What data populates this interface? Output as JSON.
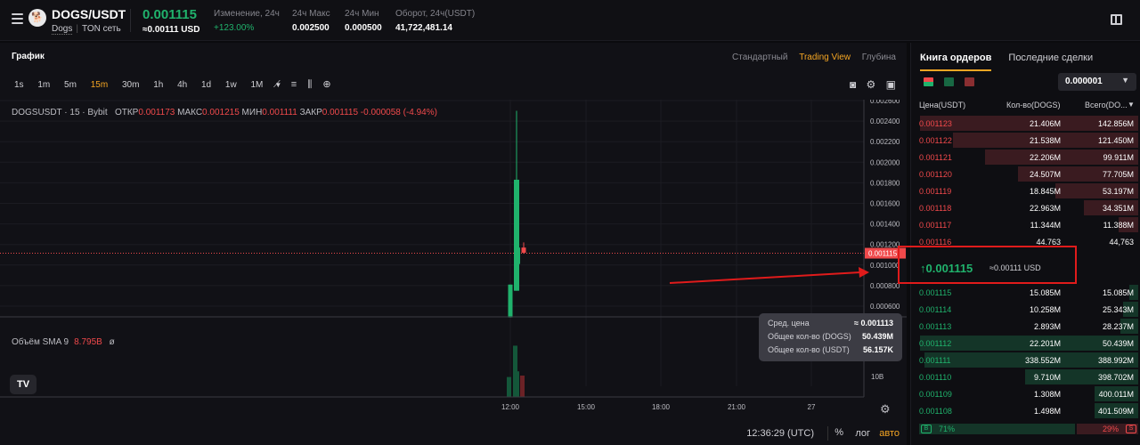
{
  "header": {
    "pair": "DOGS/USDT",
    "base": "Dogs",
    "network": "TON сеть",
    "last_price": "0.001115",
    "last_price_usd": "≈0.00111 USD",
    "stats": [
      {
        "label": "Изменение, 24ч",
        "value": "+123.00%",
        "color": "#20b26c"
      },
      {
        "label": "24ч Макс",
        "value": "0.002500"
      },
      {
        "label": "24ч Мин",
        "value": "0.000500"
      },
      {
        "label": "Оборот, 24ч(USDT)",
        "value": "41,722,481.14"
      }
    ]
  },
  "chart_panel": {
    "title": "График",
    "views": [
      "Стандартный",
      "Trading View",
      "Глубина"
    ],
    "active_view": "Trading View",
    "timeframes": [
      "1s",
      "1m",
      "5m",
      "15m",
      "30m",
      "1h",
      "4h",
      "1d",
      "1w",
      "1M"
    ],
    "active_timeframe": "15m",
    "ohlc": {
      "symbol": "DOGSUSDT · 15 · Bybit",
      "open_label": "ОТКР",
      "open": "0.001173",
      "high_label": "МАКС",
      "high": "0.001215",
      "low_label": "МИН",
      "low": "0.001111",
      "close_label": "ЗАКР",
      "close": "0.001115",
      "change": "-0.000058 (-4.94%)"
    },
    "volume_legend": {
      "label": "Объём SMA 9",
      "value": "8.795B",
      "extra": "ø"
    },
    "tv_logo": "TV",
    "tooltip": [
      {
        "label": "Сред. цена",
        "value": "≈ 0.001113"
      },
      {
        "label": "Общее кол-во (DOGS)",
        "value": "50.439M"
      },
      {
        "label": "Общее кол-во (USDT)",
        "value": "56.157K"
      }
    ],
    "bottom": {
      "time": "12:36:29 (UTC)",
      "percent": "%",
      "log": "лог",
      "auto": "авто"
    }
  },
  "chart_data": {
    "type": "candlestick",
    "y_ticks": [
      "0.002600",
      "0.002400",
      "0.002200",
      "0.002000",
      "0.001800",
      "0.001600",
      "0.001400",
      "0.001200",
      "0.001000",
      "0.000800",
      "0.000600"
    ],
    "x_ticks": [
      "12:00",
      "15:00",
      "18:00",
      "21:00",
      "27"
    ],
    "current_price_label": "0.001115",
    "volume_tick": "10B",
    "ylim": [
      0.0005,
      0.0026
    ],
    "candles": [
      {
        "open": 0.00049,
        "close": 0.00081,
        "high": 0.00081,
        "low": 0.00049,
        "dir": "up"
      },
      {
        "open": 0.00075,
        "close": 0.00183,
        "high": 0.0025,
        "low": 0.00075,
        "dir": "up"
      },
      {
        "open": 0.00101,
        "close": 0.00117,
        "high": 0.00132,
        "low": 0.00101,
        "dir": "up"
      },
      {
        "open": 0.00117,
        "close": 0.00112,
        "high": 0.00122,
        "low": 0.00111,
        "dir": "down"
      }
    ],
    "volumes": [
      {
        "value": 2.8,
        "dir": "up"
      },
      {
        "value": 7.2,
        "dir": "up"
      },
      {
        "value": 3.6,
        "dir": "up"
      },
      {
        "value": 3.0,
        "dir": "down"
      }
    ]
  },
  "orderbook": {
    "tabs": [
      "Книга ордеров",
      "Последние сделки"
    ],
    "active_tab": "Книга ордеров",
    "precision": "0.000001",
    "columns": [
      "Цена(USDT)",
      "Кол-во(DOGS)",
      "Всего(DO..."
    ],
    "asks": [
      {
        "price": "0.001123",
        "qty": "21.406M",
        "total": "142.856M",
        "depth": 1.0
      },
      {
        "price": "0.001122",
        "qty": "21.538M",
        "total": "121.450M",
        "depth": 0.85
      },
      {
        "price": "0.001121",
        "qty": "22.206M",
        "total": "99.911M",
        "depth": 0.7
      },
      {
        "price": "0.001120",
        "qty": "24.507M",
        "total": "77.705M",
        "depth": 0.55
      },
      {
        "price": "0.001119",
        "qty": "18.845M",
        "total": "53.197M",
        "depth": 0.38
      },
      {
        "price": "0.001118",
        "qty": "22.963M",
        "total": "34.351M",
        "depth": 0.25
      },
      {
        "price": "0.001117",
        "qty": "11.344M",
        "total": "11.388M",
        "depth": 0.09
      },
      {
        "price": "0.001116",
        "qty": "44.763",
        "total": "44,763",
        "depth": 0.0
      }
    ],
    "mid_price": "0.001115",
    "mid_usd": "≈0.00111 USD",
    "bids": [
      {
        "price": "0.001115",
        "qty": "15.085M",
        "total": "15.085M",
        "depth": 0.04
      },
      {
        "price": "0.001114",
        "qty": "10.258M",
        "total": "25.343M",
        "depth": 0.07
      },
      {
        "price": "0.001113",
        "qty": "2.893M",
        "total": "28.237M",
        "depth": 0.08
      },
      {
        "price": "0.001112",
        "qty": "22.201M",
        "total": "50.439M",
        "depth": 1.0
      },
      {
        "price": "0.001111",
        "qty": "338.552M",
        "total": "388.992M",
        "depth": 0.98
      },
      {
        "price": "0.001110",
        "qty": "9.710M",
        "total": "398.702M",
        "depth": 0.52
      },
      {
        "price": "0.001109",
        "qty": "1.308M",
        "total": "400.011M",
        "depth": 0.2
      },
      {
        "price": "0.001108",
        "qty": "1.498M",
        "total": "401.509M",
        "depth": 0.2
      }
    ],
    "ratio": {
      "buy_label": "B",
      "buy": "71%",
      "sell_label": "S",
      "sell": "29%"
    }
  }
}
